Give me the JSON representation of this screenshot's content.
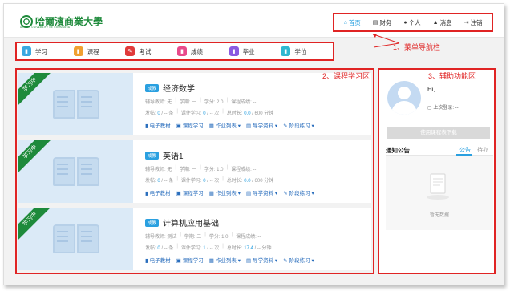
{
  "header": {
    "logo_text": "哈爾濱商業大學",
    "logo_sub": "HARBIN UNIVERSITY OF COMMERCE",
    "nav": [
      {
        "label": "首页",
        "icon": "home-icon",
        "glyph": "⌂",
        "active": true
      },
      {
        "label": "财务",
        "icon": "finance-icon",
        "glyph": "▤",
        "active": false
      },
      {
        "label": "个人",
        "icon": "user-icon",
        "glyph": "●",
        "active": false
      },
      {
        "label": "消息",
        "icon": "bell-icon",
        "glyph": "▲",
        "active": false
      },
      {
        "label": "注销",
        "icon": "logout-icon",
        "glyph": "⇥",
        "active": false
      }
    ]
  },
  "annotations": {
    "menu": "1、菜单导航栏",
    "course": "2、课程学习区",
    "aux": "3、辅助功能区"
  },
  "menu": [
    {
      "label": "学习",
      "icon": "study-icon",
      "color": "#3aa8e0",
      "glyph": "▮"
    },
    {
      "label": "课程",
      "icon": "course-icon",
      "color": "#f0a030",
      "glyph": "▮"
    },
    {
      "label": "考试",
      "icon": "exam-icon",
      "color": "#e03a3a",
      "glyph": "✎"
    },
    {
      "label": "成绩",
      "icon": "grade-icon",
      "color": "#e84a8a",
      "glyph": "▮"
    },
    {
      "label": "毕业",
      "icon": "graduate-icon",
      "color": "#8a5ae0",
      "glyph": "▮"
    },
    {
      "label": "学位",
      "icon": "degree-icon",
      "color": "#30b8d0",
      "glyph": "▮"
    }
  ],
  "courses": [
    {
      "ribbon": "学习中",
      "badge": "成教",
      "title": "经济数学",
      "teacher": "辅导教师: 无",
      "term": "学期: 一",
      "credit": "学分: 2.0",
      "score": "课程成绩: --",
      "posts_label": "发帖: ",
      "posts": "0",
      "posts_unit": " / -- 条",
      "video_label": "课件学习: ",
      "video": "0",
      "video_unit": " / -- 次",
      "time_label": "总时长: ",
      "time": "0.0",
      "time_unit": " / 600 分钟",
      "links": [
        "电子教材",
        "课程学习",
        "作业列表",
        "导学资料",
        "阶段练习"
      ]
    },
    {
      "ribbon": "学习中",
      "badge": "成教",
      "title": "英语1",
      "teacher": "辅导教师: 无",
      "term": "学期: 一",
      "credit": "学分: 1.0",
      "score": "课程成绩: --",
      "posts_label": "发帖: ",
      "posts": "0",
      "posts_unit": " / -- 条",
      "video_label": "课件学习: ",
      "video": "0",
      "video_unit": " / -- 次",
      "time_label": "总时长: ",
      "time": "0.0",
      "time_unit": " / 600 分钟",
      "links": [
        "电子教材",
        "课程学习",
        "作业列表",
        "导学资料",
        "阶段练习"
      ]
    },
    {
      "ribbon": "学习中",
      "badge": "成教",
      "title": "计算机应用基础",
      "teacher": "辅导教师: 测试",
      "term": "学期: 二",
      "credit": "学分: 1.0",
      "score": "课程成绩: --",
      "posts_label": "发帖: ",
      "posts": "0",
      "posts_unit": " / -- 条",
      "video_label": "课件学习: ",
      "video": "1",
      "video_unit": " / -- 次",
      "time_label": "总时长: ",
      "time": "17.4",
      "time_unit": " / -- 分钟",
      "links": [
        "电子教材",
        "课程学习",
        "作业列表",
        "导学资料",
        "阶段练习"
      ]
    }
  ],
  "sidebar": {
    "greeting": "Hi,",
    "last_login": "上次登录: --",
    "download_button": "使用课程表下载",
    "notice_title": "通知公告",
    "tabs": [
      "公告",
      "待办"
    ],
    "empty_text": "暂无数据"
  },
  "colors": {
    "accent": "#2aa0e0",
    "brand": "#1e8a3b",
    "annotation": "#e02424"
  }
}
